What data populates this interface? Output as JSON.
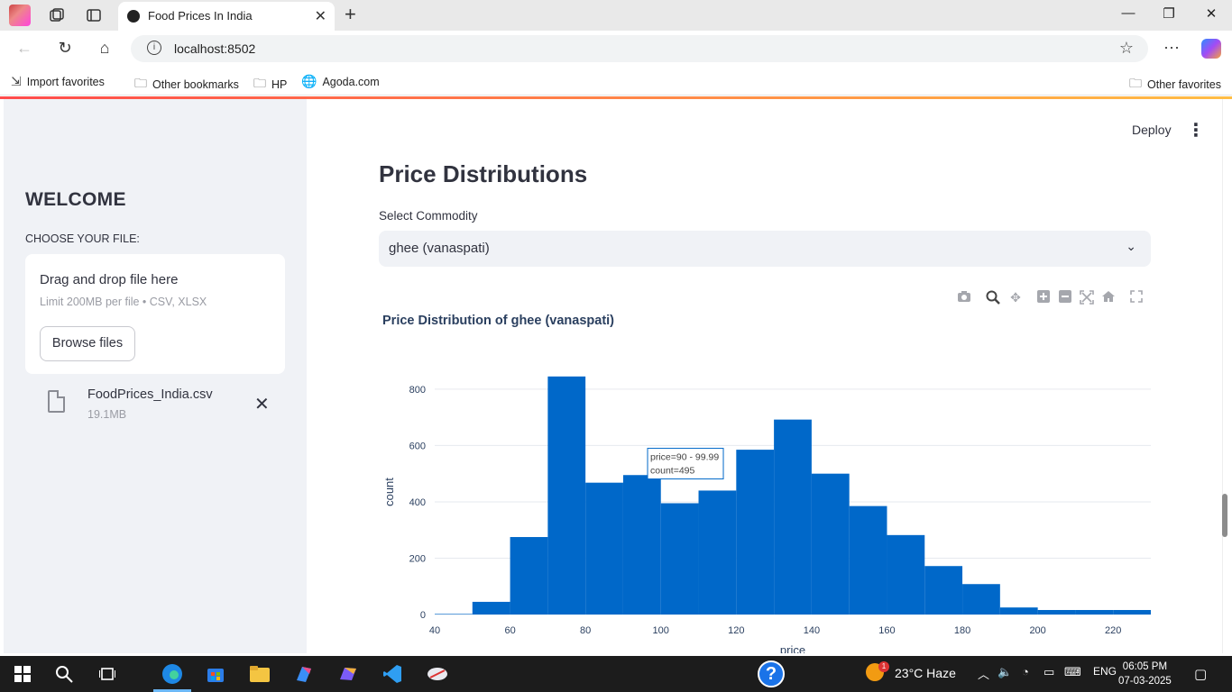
{
  "browser": {
    "tab_title": "Food Prices In India",
    "url": "localhost:8502",
    "bookmarks": [
      "Import favorites",
      "Other bookmarks",
      "HP",
      "Agoda.com"
    ],
    "other_favorites": "Other favorites"
  },
  "sidebar": {
    "welcome": "WELCOME",
    "choose_label": "CHOOSE YOUR FILE:",
    "drop_title": "Drag and drop file here",
    "drop_hint": "Limit 200MB per file • CSV, XLSX",
    "browse_label": "Browse files",
    "file_name": "FoodPrices_India.csv",
    "file_size": "19.1MB"
  },
  "header": {
    "deploy_label": "Deploy"
  },
  "main": {
    "title": "Price Distributions",
    "select_label": "Select Commodity",
    "select_value": "ghee (vanaspati)"
  },
  "chart_data": {
    "type": "bar",
    "title": "Price Distribution of ghee (vanaspati)",
    "xlabel": "price",
    "ylabel": "count",
    "bin_width": 10,
    "bins": [
      {
        "x0": 40,
        "x1": 50,
        "count": 2
      },
      {
        "x0": 50,
        "x1": 60,
        "count": 45
      },
      {
        "x0": 60,
        "x1": 70,
        "count": 275
      },
      {
        "x0": 70,
        "x1": 80,
        "count": 845
      },
      {
        "x0": 80,
        "x1": 90,
        "count": 468
      },
      {
        "x0": 90,
        "x1": 100,
        "count": 495
      },
      {
        "x0": 100,
        "x1": 110,
        "count": 395
      },
      {
        "x0": 110,
        "x1": 120,
        "count": 440
      },
      {
        "x0": 120,
        "x1": 130,
        "count": 585
      },
      {
        "x0": 130,
        "x1": 140,
        "count": 692
      },
      {
        "x0": 140,
        "x1": 150,
        "count": 500
      },
      {
        "x0": 150,
        "x1": 160,
        "count": 385
      },
      {
        "x0": 160,
        "x1": 170,
        "count": 282
      },
      {
        "x0": 170,
        "x1": 180,
        "count": 172
      },
      {
        "x0": 180,
        "x1": 190,
        "count": 108
      },
      {
        "x0": 190,
        "x1": 200,
        "count": 25
      },
      {
        "x0": 200,
        "x1": 210,
        "count": 16
      },
      {
        "x0": 210,
        "x1": 220,
        "count": 16
      },
      {
        "x0": 220,
        "x1": 230,
        "count": 16
      }
    ],
    "xlim": [
      40,
      230
    ],
    "ylim": [
      0,
      870
    ],
    "xticks": [
      40,
      60,
      80,
      100,
      120,
      140,
      160,
      180,
      200,
      220
    ],
    "yticks": [
      0,
      200,
      400,
      600,
      800
    ],
    "bar_color": "#0068c9",
    "hover": {
      "line1": "price=90 - 99.99",
      "line2": "count=495"
    }
  },
  "taskbar": {
    "weather": "23°C  Haze",
    "badge": "1",
    "lang": "ENG",
    "time": "06:05 PM",
    "date": "07-03-2025"
  }
}
